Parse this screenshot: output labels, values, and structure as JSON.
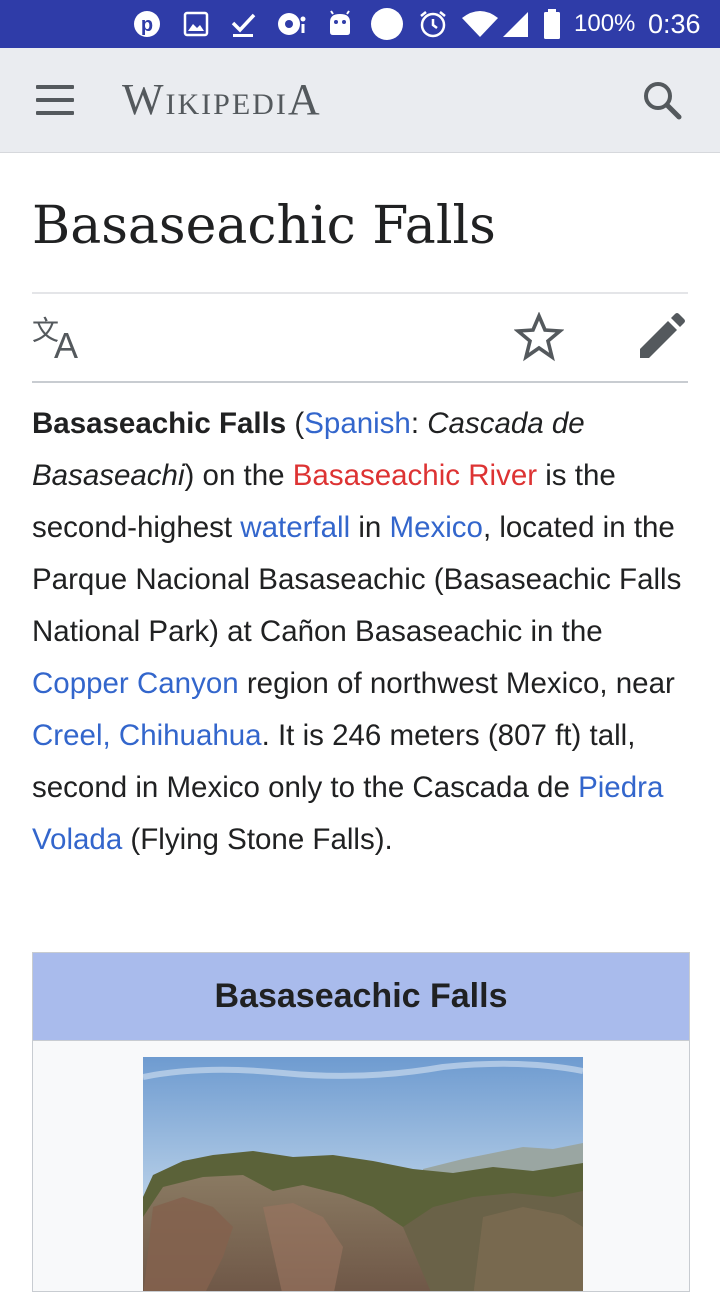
{
  "status_bar": {
    "battery": "100%",
    "time": "0:36",
    "icons": [
      "pinterest-icon",
      "image-icon",
      "download-done-icon",
      "settings-remote-icon",
      "android-icon",
      "circle-icon",
      "alarm-icon",
      "wifi-icon",
      "signal-icon",
      "battery-icon"
    ]
  },
  "header": {
    "wordmark_first_big": "W",
    "wordmark_rest": "IKIPEDI",
    "wordmark_last_big": "A",
    "icons": [
      "menu-icon",
      "search-icon"
    ]
  },
  "article": {
    "title": "Basaseachic Falls",
    "actions": [
      "language-icon",
      "watch-star-icon",
      "edit-pencil-icon"
    ],
    "lead": {
      "subject": "Basaseachic Falls",
      "open_paren": " (",
      "link_spanish": "Spanish",
      "colon": ": ",
      "native_name": "Cascada de Basaseachi",
      "close_paren_on": ") on the ",
      "link_river": "Basaseachic River",
      "t1": " is the second-highest ",
      "link_waterfall": "waterfall",
      "t2": " in ",
      "link_mexico": "Mexico",
      "t3": ", located in the Parque Nacional Basaseachic (Basaseachic Falls National Park) at Cañon Basaseachic in the ",
      "link_copper": "Copper Canyon",
      "t4": " region of northwest Mexico, near ",
      "link_creel": "Creel, Chihuahua",
      "t5": ". It is 246 meters (807 ft) tall, second in Mexico only to the Cascada de ",
      "link_piedra": "Piedra Volada",
      "t6": " (Flying Stone Falls)."
    },
    "infobox": {
      "title": "Basaseachic Falls",
      "image": "canyon-photo"
    }
  },
  "colors": {
    "status_bar": "#2f3ca8",
    "toolbar": "#eaecf0",
    "link": "#3366cc",
    "red_link": "#dd3333",
    "infobox_header": "#a9bbec",
    "text": "#202122"
  }
}
